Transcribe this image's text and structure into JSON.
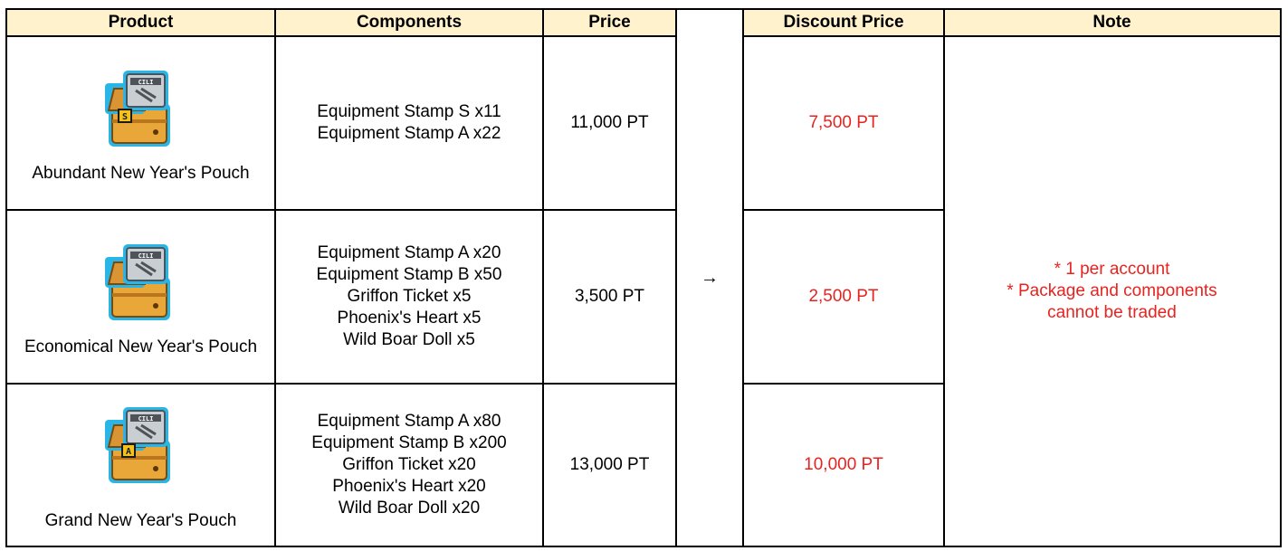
{
  "headers": {
    "product": "Product",
    "components": "Components",
    "price": "Price",
    "discount": "Discount Price",
    "note": "Note"
  },
  "arrow": "→",
  "rows": [
    {
      "product": "Abundant New Year's Pouch",
      "badge": "S",
      "stamp_text": "CILI",
      "components": [
        "Equipment Stamp S x11",
        "Equipment Stamp A x22"
      ],
      "price": "11,000 PT",
      "discount": "7,500 PT"
    },
    {
      "product": "Economical New Year's Pouch",
      "badge": "",
      "stamp_text": "CILI",
      "components": [
        "Equipment Stamp A x20",
        "Equipment Stamp B x50",
        "Griffon Ticket x5",
        "Phoenix's Heart x5",
        "Wild Boar Doll x5"
      ],
      "price": "3,500 PT",
      "discount": "2,500 PT"
    },
    {
      "product": "Grand New Year's Pouch",
      "badge": "A",
      "stamp_text": "CILI",
      "components": [
        "Equipment Stamp A x80",
        "Equipment Stamp B x200",
        "Griffon Ticket x20",
        "Phoenix's Heart x20",
        "Wild Boar Doll x20"
      ],
      "price": "13,000 PT",
      "discount": "10,000 PT"
    }
  ],
  "note": [
    "* 1 per account",
    "* Package and components",
    "cannot be traded"
  ],
  "colors": {
    "header_bg": "#fff2cc",
    "discount_text": "#e8231f",
    "border": "#000000",
    "chest": "#e9a73a",
    "chest_outline": "#29b6e6"
  }
}
